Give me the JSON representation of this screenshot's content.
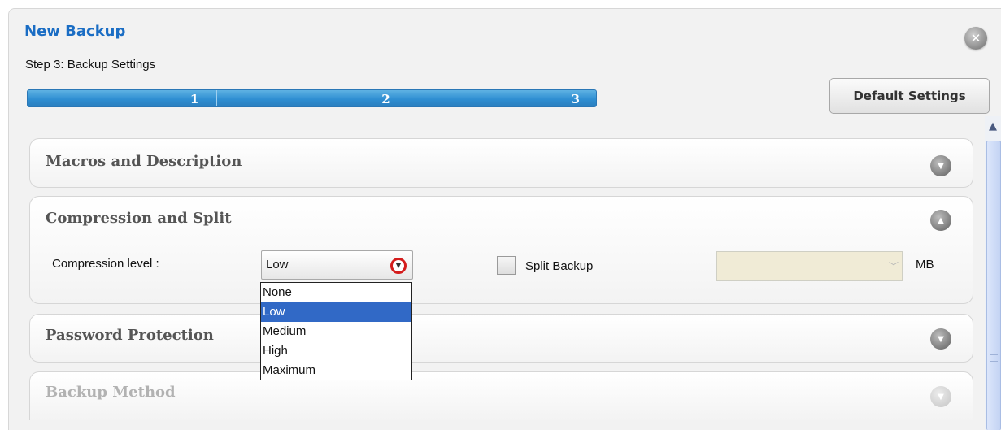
{
  "dialog": {
    "title": "New Backup",
    "step_title": "Step 3: Backup Settings",
    "close_icon": "close-icon",
    "progress": {
      "steps": [
        "1",
        "2",
        "3"
      ],
      "current_step": 3
    },
    "default_settings_label": "Default Settings"
  },
  "panels": {
    "macros": {
      "title": "Macros and Description",
      "state": "collapsed"
    },
    "compression": {
      "title": "Compression and Split",
      "state": "expanded"
    },
    "password": {
      "title": "Password Protection",
      "state": "collapsed"
    },
    "method": {
      "title": "Backup Method",
      "state": "disabled"
    }
  },
  "compression": {
    "level_label": "Compression level :",
    "selected_value": "Low",
    "options": [
      "None",
      "Low",
      "Medium",
      "High",
      "Maximum"
    ],
    "highlighted_option": "Low"
  },
  "split": {
    "label": "Split Backup",
    "checked": false,
    "size_value": "",
    "unit_label": "MB"
  },
  "colors": {
    "title": "#1a6dc4",
    "progress": "#2f8ed2",
    "highlight": "#3169c6",
    "dropdown_indicator": "#d41c1c"
  }
}
